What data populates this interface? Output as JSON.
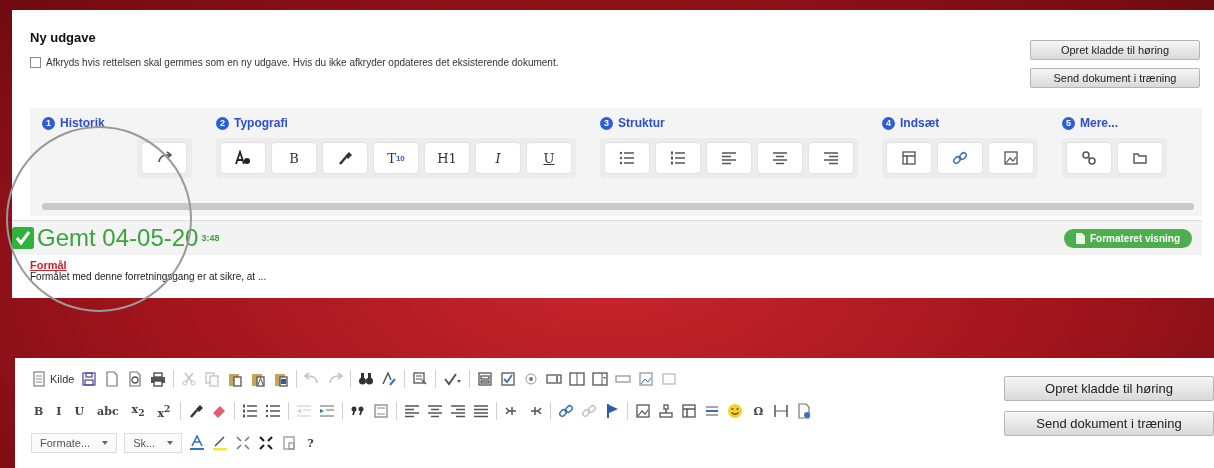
{
  "top_panel": {
    "title": "Ny udgave",
    "new_version": {
      "checked": false,
      "label": "Afkryds hvis rettelsen skal gemmes som en ny udgave. Hvis du ikke afkryder opdateres det eksisterende dokument."
    },
    "buttons": [
      "Opret kladde til høring",
      "Send dokument i træning"
    ],
    "toolbar_groups": [
      {
        "number": "1",
        "title": "Historik",
        "items": [
          {
            "kind": "redo"
          }
        ]
      },
      {
        "number": "2",
        "title": "Typografi",
        "items": [
          {
            "kind": "fontstyle"
          },
          {
            "label": "B"
          },
          {
            "kind": "brush"
          },
          {
            "label": "T",
            "sub": "10"
          },
          {
            "label": "H1"
          },
          {
            "label": "I",
            "italic": true
          },
          {
            "label": "U",
            "underline": true
          }
        ]
      },
      {
        "number": "3",
        "title": "Struktur",
        "items": [
          {
            "kind": "bulletlist"
          },
          {
            "kind": "numberedlist"
          },
          {
            "kind": "alignleft"
          },
          {
            "kind": "aligncenter"
          },
          {
            "kind": "alignright"
          }
        ]
      },
      {
        "number": "4",
        "title": "Indsæt",
        "items": [
          {
            "kind": "table"
          },
          {
            "kind": "link"
          },
          {
            "kind": "image"
          }
        ]
      },
      {
        "number": "5",
        "title": "Mere...",
        "items": [
          {
            "kind": "anchor"
          },
          {
            "kind": "folder"
          }
        ]
      }
    ],
    "saved": {
      "text": "Gemt 04-05-20",
      "time": "3:48"
    },
    "preview_button": "Formateret visning",
    "content": {
      "heading": "Formål",
      "text": "Formålet med denne forretningsgang er at sikre, at ..."
    }
  },
  "bottom_panel": {
    "toolbar_rows": [
      {
        "items": [
          {
            "kind": "source",
            "label": "Kilde"
          },
          {
            "kind": "save"
          },
          {
            "kind": "newpage"
          },
          {
            "kind": "preview"
          },
          {
            "kind": "print"
          },
          {
            "kind": "sep"
          },
          {
            "kind": "cut",
            "disabled": true
          },
          {
            "kind": "copy",
            "disabled": true
          },
          {
            "kind": "paste"
          },
          {
            "kind": "pastetext"
          },
          {
            "kind": "pasteword"
          },
          {
            "kind": "sep"
          },
          {
            "kind": "undo",
            "disabled": true
          },
          {
            "kind": "redo",
            "disabled": true
          },
          {
            "kind": "sep"
          },
          {
            "kind": "find"
          },
          {
            "kind": "replace"
          },
          {
            "kind": "sep"
          },
          {
            "kind": "selectall"
          },
          {
            "kind": "sep"
          },
          {
            "kind": "spellcheck"
          },
          {
            "kind": "sep"
          },
          {
            "kind": "form"
          },
          {
            "kind": "checkbox"
          },
          {
            "kind": "radio"
          },
          {
            "kind": "textfield"
          },
          {
            "kind": "textarea"
          },
          {
            "kind": "select"
          },
          {
            "kind": "button"
          },
          {
            "kind": "imagebutton"
          },
          {
            "kind": "hiddenfield"
          }
        ]
      },
      {
        "items": [
          {
            "kind": "text",
            "label": "B"
          },
          {
            "kind": "text",
            "label": "I"
          },
          {
            "kind": "text",
            "label": "U"
          },
          {
            "kind": "text",
            "label": "abc"
          },
          {
            "kind": "text",
            "label": "x$_{2}$"
          },
          {
            "kind": "text",
            "label": "x$^{2}$"
          },
          {
            "kind": "sep"
          },
          {
            "kind": "brush"
          },
          {
            "kind": "eraser"
          },
          {
            "kind": "sep"
          },
          {
            "kind": "numberedlist"
          },
          {
            "kind": "bulletlist"
          },
          {
            "kind": "sep"
          },
          {
            "kind": "outdent",
            "disabled": true
          },
          {
            "kind": "indent"
          },
          {
            "kind": "sep"
          },
          {
            "kind": "quote"
          },
          {
            "kind": "div"
          },
          {
            "kind": "sep"
          },
          {
            "kind": "alignleft"
          },
          {
            "kind": "aligncenter"
          },
          {
            "kind": "alignright"
          },
          {
            "kind": "justify"
          },
          {
            "kind": "sep"
          },
          {
            "kind": "ltr"
          },
          {
            "kind": "rtl"
          },
          {
            "kind": "sep"
          },
          {
            "kind": "link"
          },
          {
            "kind": "unlink",
            "disabled": true
          },
          {
            "kind": "flag"
          },
          {
            "kind": "sep"
          },
          {
            "kind": "image"
          },
          {
            "kind": "flash"
          },
          {
            "kind": "table"
          },
          {
            "kind": "hline"
          },
          {
            "kind": "smiley"
          },
          {
            "kind": "text",
            "label": "Ω"
          },
          {
            "kind": "pagebreak"
          },
          {
            "kind": "iframe"
          }
        ]
      },
      {
        "items": [
          {
            "kind": "dropdown",
            "label": "Formate..."
          },
          {
            "kind": "dropdown",
            "label": "Sk..."
          },
          {
            "kind": "textcolor"
          },
          {
            "kind": "bgcolor"
          },
          {
            "kind": "maximize"
          },
          {
            "kind": "showblocks"
          },
          {
            "kind": "template"
          },
          {
            "kind": "text",
            "label": "?"
          }
        ]
      }
    ],
    "buttons": [
      "Opret kladde til høring",
      "Send dokument i træning"
    ]
  }
}
